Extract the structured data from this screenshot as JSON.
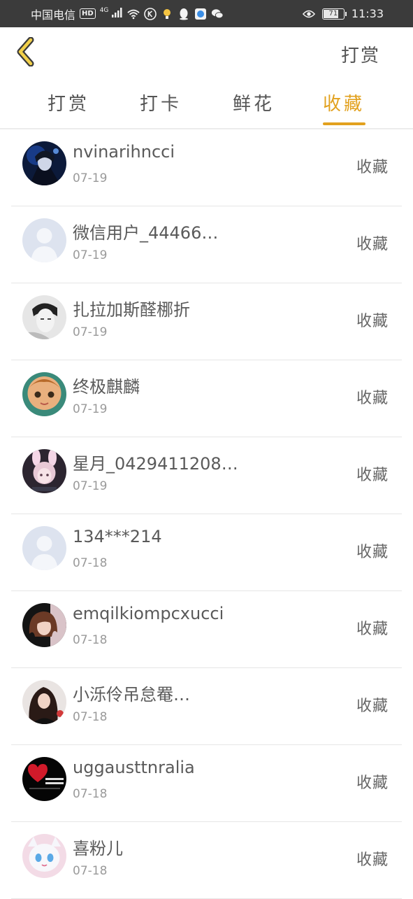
{
  "status_bar": {
    "carrier": "中国电信",
    "hd": "HD",
    "network": "4G",
    "battery": "71",
    "time": "11:33"
  },
  "header": {
    "title": "打赏"
  },
  "tabs": [
    {
      "label": "打赏",
      "active": false
    },
    {
      "label": "打卡",
      "active": false
    },
    {
      "label": "鲜花",
      "active": false
    },
    {
      "label": "收藏",
      "active": true
    }
  ],
  "colors": {
    "accent": "#e2a11e",
    "status_bar": "#3b3b3b"
  },
  "list": [
    {
      "name": "nvinarihncci",
      "date": "07-19",
      "action": "收藏",
      "avatar": "dark-anime"
    },
    {
      "name": "微信用户_44466…",
      "date": "07-19",
      "action": "收藏",
      "avatar": "default"
    },
    {
      "name": "扎拉加斯醛梛折",
      "date": "07-19",
      "action": "收藏",
      "avatar": "bw-portrait"
    },
    {
      "name": "终极麒麟",
      "date": "07-19",
      "action": "收藏",
      "avatar": "doll"
    },
    {
      "name": "星月_0429411208…",
      "date": "07-19",
      "action": "收藏",
      "avatar": "pink-bunny"
    },
    {
      "name": "134***214",
      "date": "07-18",
      "action": "收藏",
      "avatar": "default"
    },
    {
      "name": "emqilkiompcxucci",
      "date": "07-18",
      "action": "收藏",
      "avatar": "girl-bob"
    },
    {
      "name": "小泺伶吊怠罨…",
      "date": "07-18",
      "action": "收藏",
      "avatar": "girl-long"
    },
    {
      "name": "uggausttnralia",
      "date": "07-18",
      "action": "收藏",
      "avatar": "black-heart"
    },
    {
      "name": "喜粉儿",
      "date": "07-18",
      "action": "收藏",
      "avatar": "anime-cat"
    }
  ]
}
